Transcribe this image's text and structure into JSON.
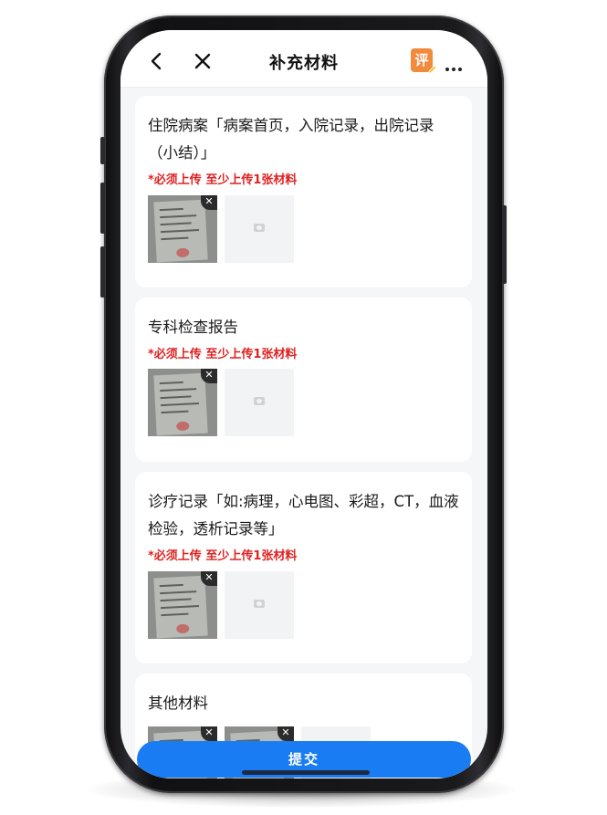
{
  "header": {
    "title": "补充材料",
    "badge_label": "评"
  },
  "sections": [
    {
      "title": "住院病案「病案首页，入院记录，出院记录（小结）」",
      "requirement": "*必须上传 至少上传1张材料"
    },
    {
      "title": "专科检查报告",
      "requirement": "*必须上传 至少上传1张材料"
    },
    {
      "title": "诊疗记录「如:病理，心电图、彩超，CT，血液检验，透析记录等」",
      "requirement": "*必须上传 至少上传1张材料"
    },
    {
      "title": "其他材料"
    }
  ],
  "footer": {
    "submit_label": "提交"
  },
  "colors": {
    "accent": "#1a7cf2",
    "required_text": "#e02020",
    "badge": "#f28a3c"
  },
  "icons": [
    "back-arrow-icon",
    "close-icon",
    "review-badge-icon",
    "more-icon",
    "delete-icon",
    "camera-icon"
  ]
}
